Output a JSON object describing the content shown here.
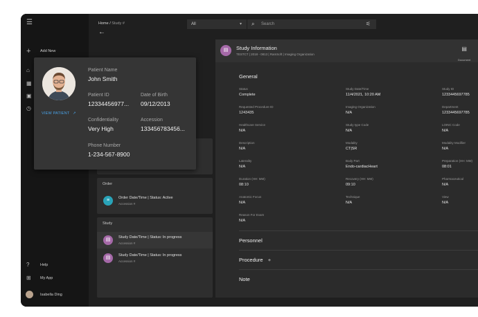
{
  "sidebar": {
    "add_label": "Add New",
    "help_label": "Help",
    "myapp_label": "My App",
    "user_name": "Isabella Ding"
  },
  "topbar": {
    "breadcrumb_home": "Home /",
    "breadcrumb_current": "Study #",
    "filter_value": "All",
    "search_placeholder": "Search"
  },
  "patient": {
    "name_label": "Patient Name",
    "name": "John Smith",
    "id_label": "Patient ID",
    "id": "12334456977...",
    "dob_label": "Date of Birth",
    "dob": "09/12/2013",
    "confidentiality_label": "Confidentiality",
    "confidentiality": "Very High",
    "accession_label": "Accession",
    "accession": "133456783456...",
    "phone_label": "Phone Number",
    "phone": "1-234-567-8900",
    "view_link": "VIEW PATIENT"
  },
  "order_panel": {
    "title": "Order",
    "item_title": "Order Date/Time | Status: Active",
    "item_sub": "Accession #"
  },
  "study_panel": {
    "title": "Study",
    "items": [
      {
        "title": "Study Date/Time | Status: In progress",
        "sub": "Accession #"
      },
      {
        "title": "Study Date/Time | Status: In progress",
        "sub": "Accession #"
      }
    ]
  },
  "study_info": {
    "title": "Study Information",
    "subtitle": "TESTCT | 2018 - 0813 | RamSoft | Imaging Organization",
    "document_label": "Document",
    "general_title": "General",
    "fields": [
      {
        "label": "Status",
        "value": "Complete"
      },
      {
        "label": "Study Date/Time",
        "value": "11/4/2021, 10:20 AM"
      },
      {
        "label": "Study ID",
        "value": "1233445697785"
      },
      {
        "label": "Requested Procedure ID",
        "value": "1243435"
      },
      {
        "label": "Imaging Organization",
        "value": "N/A"
      },
      {
        "label": "Department",
        "value": "1233445697785"
      },
      {
        "label": "Healthcare Service",
        "value": "N/A"
      },
      {
        "label": "Study type Code",
        "value": "N/A"
      },
      {
        "label": "LOINC Code",
        "value": "N/A"
      },
      {
        "label": "Description",
        "value": "N/A"
      },
      {
        "label": "Modality",
        "value": "CT|SR"
      },
      {
        "label": "Modality Modifier",
        "value": "N/A"
      },
      {
        "label": "Laterality",
        "value": "N/A"
      },
      {
        "label": "Body Part",
        "value": "Endo-cardiacHeart"
      },
      {
        "label": "Preparation (HH: MM)",
        "value": "08:01"
      },
      {
        "label": "Duration (HH: MM)",
        "value": "08:10"
      },
      {
        "label": "Recovery (HH: MM)",
        "value": "09:10"
      },
      {
        "label": "Pharmaceutical",
        "value": "N/A"
      },
      {
        "label": "Anatomic Focus",
        "value": "N/A"
      },
      {
        "label": "Technique",
        "value": "N/A"
      },
      {
        "label": "View",
        "value": "N/A"
      },
      {
        "label": "Reason For Exam",
        "value": "N/A"
      }
    ],
    "personnel_title": "Personnel",
    "procedure_title": "Procedure",
    "note_title": "Note"
  },
  "colors": {
    "accent_blue": "#4aa3e8",
    "order_icon": "#29a3b8",
    "study_icon": "#a569a8"
  },
  "icons": [
    "menu-icon",
    "plus-icon",
    "home-icon",
    "grid-icon",
    "image-icon",
    "history-icon",
    "search-icon",
    "filter-icon",
    "document-icon",
    "arrow-back-icon",
    "external-link-icon"
  ]
}
